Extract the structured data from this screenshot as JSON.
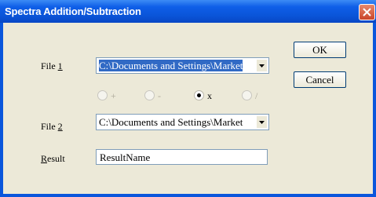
{
  "window": {
    "title": "Spectra Addition/Subtraction"
  },
  "file1": {
    "label_pre": "File ",
    "label_key": "1",
    "value": "C:\\Documents and Settings\\Market"
  },
  "file2": {
    "label_pre": "File ",
    "label_key": "2",
    "value": "C:\\Documents and Settings\\Market"
  },
  "operations": [
    {
      "label": "+",
      "checked": false
    },
    {
      "label": "-",
      "checked": false
    },
    {
      "label": "x",
      "checked": true
    },
    {
      "label": "/",
      "checked": false
    }
  ],
  "result": {
    "label_key": "R",
    "label_rest": "esult",
    "value": "ResultName"
  },
  "buttons": {
    "ok": "OK",
    "cancel": "Cancel"
  },
  "icons": {
    "close": "close-icon",
    "dropdown": "chevron-down-icon"
  }
}
